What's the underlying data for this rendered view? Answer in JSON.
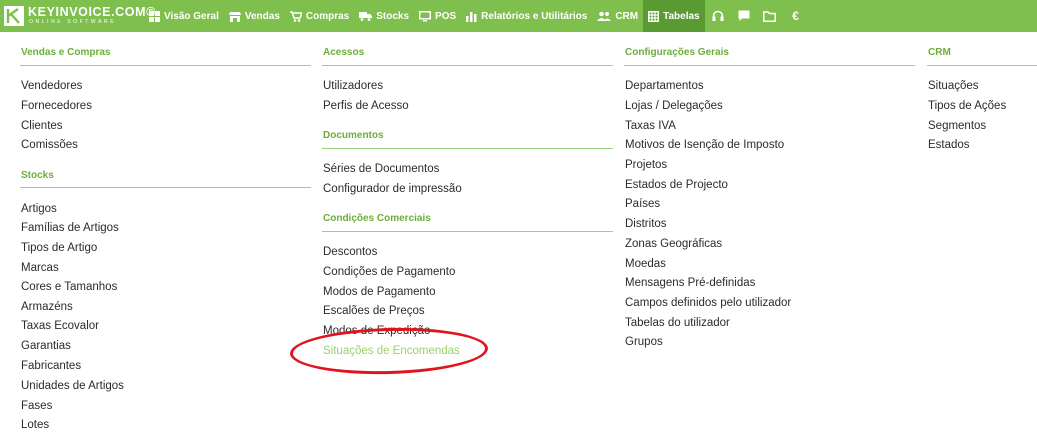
{
  "brand": {
    "name": "KEYINVOICE.COM®",
    "tagline": "ONLINE SOFTWARE"
  },
  "nav": [
    {
      "label": "Visão Geral",
      "icon": "dashboard-icon"
    },
    {
      "label": "Vendas",
      "icon": "store-icon"
    },
    {
      "label": "Compras",
      "icon": "cart-icon"
    },
    {
      "label": "Stocks",
      "icon": "truck-icon"
    },
    {
      "label": "POS",
      "icon": "monitor-icon"
    },
    {
      "label": "Relatórios e Utilitários",
      "icon": "bar-chart-icon"
    },
    {
      "label": "CRM",
      "icon": "users-icon"
    },
    {
      "label": "Tabelas",
      "icon": "table-icon",
      "active": true
    }
  ],
  "nav_icons": [
    {
      "icon": "headset-icon"
    },
    {
      "icon": "chat-icon"
    },
    {
      "icon": "folder-icon"
    },
    {
      "icon": "euro-icon",
      "glyph": "€"
    }
  ],
  "colors": {
    "accent": "#7fbf4d",
    "accent_dark": "#5a9a33",
    "section_head": "#6cae3a",
    "highlight": "#9cd06e",
    "annotation": "#e0141e"
  },
  "menu": {
    "col1": {
      "s1": {
        "title": "Vendas e Compras",
        "items": [
          "Vendedores",
          "Fornecedores",
          "Clientes",
          "Comissões"
        ]
      },
      "s2": {
        "title": "Stocks",
        "items": [
          "Artigos",
          "Famílias de Artigos",
          "Tipos de Artigo",
          "Marcas",
          "Cores e Tamanhos",
          "Armazéns",
          "Taxas Ecovalor",
          "Garantias",
          "Fabricantes",
          "Unidades de Artigos",
          "Fases",
          "Lotes"
        ]
      }
    },
    "col2": {
      "s1": {
        "title": "Acessos",
        "items": [
          "Utilizadores",
          "Perfis de Acesso"
        ]
      },
      "s2": {
        "title": "Documentos",
        "items": [
          "Séries de Documentos",
          "Configurador de impressão"
        ]
      },
      "s3": {
        "title": "Condições Comerciais",
        "items": [
          "Descontos",
          "Condições de Pagamento",
          "Modos de Pagamento",
          "Escalões de Preços",
          "Modos de Expedição",
          "Situações de Encomendas"
        ]
      }
    },
    "col3": {
      "s1": {
        "title": "Configurações Gerais",
        "items": [
          "Departamentos",
          "Lojas / Delegações",
          "Taxas IVA",
          "Motivos de Isenção de Imposto",
          "Projetos",
          "Estados de Projecto",
          "Países",
          "Distritos",
          "Zonas Geográficas",
          "Moedas",
          "Mensagens Pré-definidas",
          "Campos definidos pelo utilizador",
          "Tabelas do utilizador",
          "Grupos"
        ]
      }
    },
    "col4": {
      "s1": {
        "title": "CRM",
        "items": [
          "Situações",
          "Tipos de Ações",
          "Segmentos",
          "Estados"
        ]
      }
    }
  }
}
